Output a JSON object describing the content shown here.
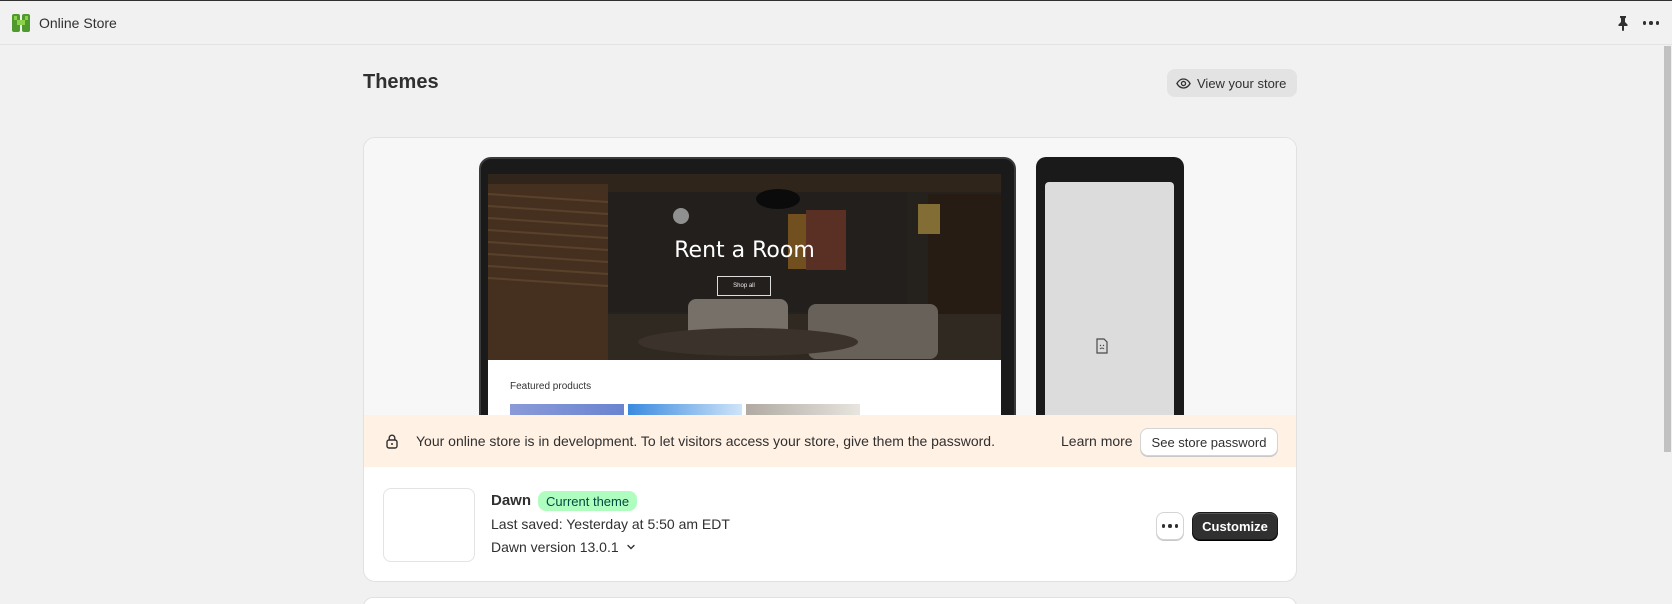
{
  "app": {
    "title": "Online Store"
  },
  "page": {
    "title": "Themes",
    "view_store_label": "View your store"
  },
  "preview": {
    "hero_title": "Rent a Room",
    "hero_button": "Shop all",
    "featured_label": "Featured products"
  },
  "banner": {
    "message": "Your online store is in development. To let visitors access your store, give them the password.",
    "learn_more": "Learn more",
    "password_button": "See store password"
  },
  "theme": {
    "name": "Dawn",
    "badge": "Current theme",
    "last_saved": "Last saved: Yesterday at 5:50 am EDT",
    "version": "Dawn version 13.0.1",
    "customize_label": "Customize"
  },
  "icons": {
    "app_logo": "shopify-store-icon",
    "pin": "pin-icon",
    "more": "more-horizontal-icon",
    "eye": "eye-icon",
    "lock": "lock-icon",
    "file": "file-icon",
    "chevron": "chevron-down-icon"
  },
  "colors": {
    "badge_bg": "#affebf",
    "banner_bg": "#fff1e3",
    "primary_button": "#303030"
  }
}
